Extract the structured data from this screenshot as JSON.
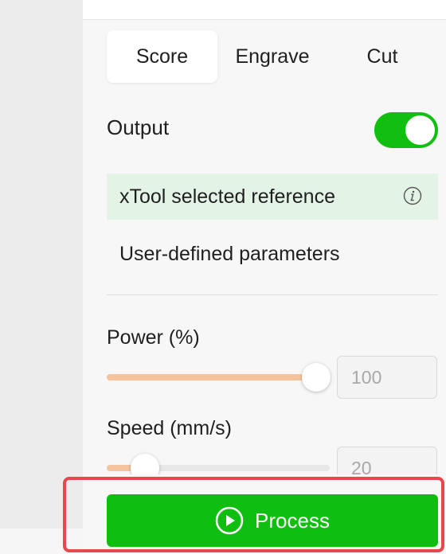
{
  "tabs": [
    "Score",
    "Engrave",
    "Cut"
  ],
  "active_tab": "Score",
  "output": {
    "label": "Output",
    "enabled": true
  },
  "options": {
    "selected": "xTool selected reference",
    "user": "User-defined parameters"
  },
  "power": {
    "label": "Power (%)",
    "value": "100",
    "fraction": 0.94
  },
  "speed": {
    "label": "Speed (mm/s)",
    "value": "20",
    "fraction": 0.17
  },
  "process_button": {
    "label": "Process"
  },
  "colors": {
    "accent": "#10bf10",
    "selected_bg": "#e3f4e6",
    "slider_fill": "#f6c49c",
    "highlight": "#e5484d"
  },
  "icons": {
    "info": "info-icon",
    "play": "play-circle-icon"
  }
}
